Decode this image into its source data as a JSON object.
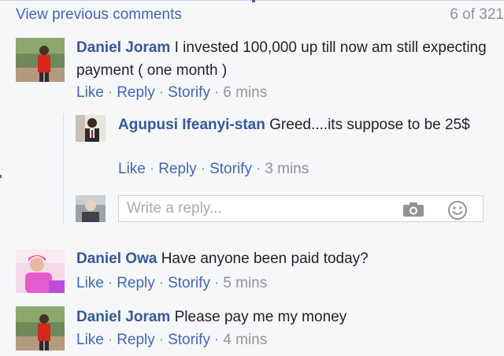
{
  "header": {
    "view_previous": "View previous comments",
    "count": "6 of 321"
  },
  "comments": [
    {
      "author": "Daniel Joram",
      "text": "I invested 100,000 up till now am still expecting payment ( one month )",
      "actions": {
        "like": "Like",
        "reply": "Reply",
        "storify": "Storify"
      },
      "time": "6 mins",
      "avatar": "avatar-photo"
    },
    {
      "author": "Agupusi Ifeanyi-stan",
      "text": "Greed....its suppose to be 25$",
      "actions": {
        "like": "Like",
        "reply": "Reply",
        "storify": "Storify"
      },
      "time": "3 mins",
      "avatar": "avatar-photo"
    },
    {
      "author": "Daniel Owa",
      "text": "Have anyone been paid today?",
      "actions": {
        "like": "Like",
        "reply": "Reply",
        "storify": "Storify"
      },
      "time": "5 mins",
      "avatar": "avatar-photo"
    },
    {
      "author": "Daniel Joram",
      "text": "Please pay me my money",
      "actions": {
        "like": "Like",
        "reply": "Reply",
        "storify": "Storify"
      },
      "time": "4 mins",
      "avatar": "avatar-photo"
    }
  ],
  "reply_box": {
    "placeholder": "Write a reply...",
    "icons": [
      "camera-icon",
      "smiley-icon"
    ]
  },
  "sep": "·"
}
